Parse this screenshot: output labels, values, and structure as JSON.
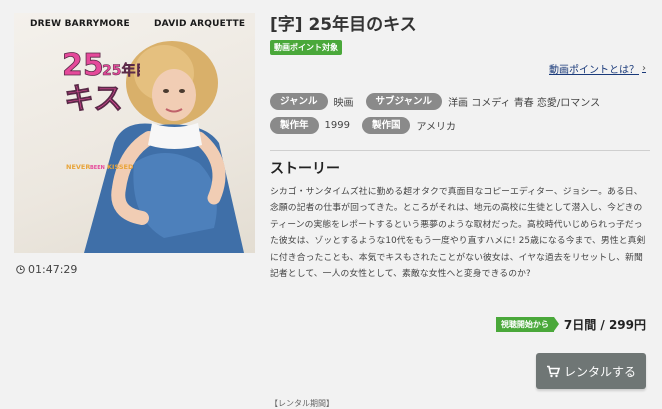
{
  "poster": {
    "actor_left": "DREW BARRYMORE",
    "actor_right": "DAVID ARQUETTE",
    "logo_line1": "25年目の",
    "logo_line2": "キス",
    "tagline_parts": [
      "NEVER",
      "BEEN",
      "KISSED"
    ]
  },
  "duration": "01:47:29",
  "title": "[字] 25年目のキス",
  "point_badge": "動画ポイント対象",
  "point_link": "動画ポイントとは？",
  "tags": {
    "genre_label": "ジャンル",
    "genre_value": "映画",
    "subgenre_label": "サブジャンル",
    "subgenre_value": "洋画 コメディ 青春 恋愛/ロマンス",
    "year_label": "製作年",
    "year_value": "1999",
    "country_label": "製作国",
    "country_value": "アメリカ"
  },
  "story": {
    "heading": "ストーリー",
    "text": "シカゴ・サンタイムズ社に勤める超オタクで真面目なコピーエディター、ジョシー。ある日、念願の記者の仕事が回ってきた。ところがそれは、地元の高校に生徒として潜入し、今どきのティーンの実態をレポートするという悪夢のような取材だった。高校時代いじめられっ子だった彼女は、ゾッとするような10代をもう一度やり直すハメに! 25歳になる今まで、男性と真剣に付き合ったことも、本気でキスもされたことがない彼女は、イヤな過去をリセットし、新聞記者として、一人の女性として、素敵な女性へと変身できるのか?"
  },
  "price": {
    "badge": "視聴開始から",
    "text": "7日間 / 299円"
  },
  "rent_button": "レンタルする",
  "rental_period": "【レンタル期間】",
  "colors": {
    "green": "#4aa83a",
    "tag_gray": "#8a8a8a",
    "button_gray": "#6f7675",
    "link_blue": "#1a3a7a"
  }
}
